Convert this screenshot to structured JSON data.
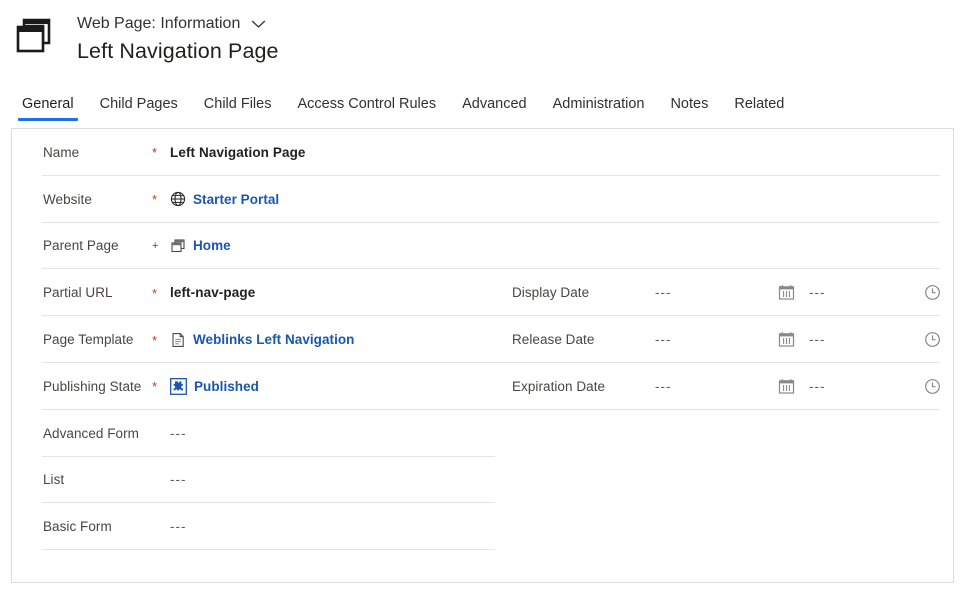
{
  "header": {
    "app_icon": "web-pages-icon",
    "entity_label": "Web Page: Information",
    "chevron_icon": "chevron-down-icon",
    "record_title": "Left Navigation Page"
  },
  "tabs": [
    {
      "label": "General",
      "active": true
    },
    {
      "label": "Child Pages",
      "active": false
    },
    {
      "label": "Child Files",
      "active": false
    },
    {
      "label": "Access Control Rules",
      "active": false
    },
    {
      "label": "Advanced",
      "active": false
    },
    {
      "label": "Administration",
      "active": false
    },
    {
      "label": "Notes",
      "active": false
    },
    {
      "label": "Related",
      "active": false
    }
  ],
  "form": {
    "left_fields": [
      {
        "label": "Name",
        "marker": "required",
        "value": "Left Navigation Page",
        "kind": "text",
        "icon": null
      },
      {
        "label": "Website",
        "marker": "required",
        "value": "Starter Portal",
        "kind": "link",
        "icon": "globe-icon"
      },
      {
        "label": "Parent Page",
        "marker": "recommended",
        "value": "Home",
        "kind": "link",
        "icon": "pages-icon"
      },
      {
        "label": "Partial URL",
        "marker": "required",
        "value": "left-nav-page",
        "kind": "text",
        "icon": null
      },
      {
        "label": "Page Template",
        "marker": "required",
        "value": "Weblinks Left Navigation",
        "kind": "link",
        "icon": "document-icon"
      },
      {
        "label": "Publishing State",
        "marker": "required",
        "value": "Published",
        "kind": "link",
        "icon": "component-icon"
      },
      {
        "label": "Advanced Form",
        "marker": "none",
        "value": "---",
        "kind": "empty",
        "icon": null
      },
      {
        "label": "List",
        "marker": "none",
        "value": "---",
        "kind": "empty",
        "icon": null
      },
      {
        "label": "Basic Form",
        "marker": "none",
        "value": "---",
        "kind": "empty",
        "icon": null
      }
    ],
    "right_fields": [
      {
        "label": "Display Date",
        "date_value": "---",
        "date_icon": "calendar-icon",
        "time_value": "---",
        "time_icon": "clock-icon"
      },
      {
        "label": "Release Date",
        "date_value": "---",
        "date_icon": "calendar-icon",
        "time_value": "---",
        "time_icon": "clock-icon"
      },
      {
        "label": "Expiration Date",
        "date_value": "---",
        "date_icon": "calendar-icon",
        "time_value": "---",
        "time_icon": "clock-icon"
      }
    ],
    "markers": {
      "required_glyph": "*",
      "recommended_glyph": "+"
    }
  },
  "colors": {
    "link": "#1a56b0",
    "required": "#c0392b",
    "recommended": "#1f4ed8",
    "tab_active_underline": "#1f6feb",
    "divider": "#e4e4e4",
    "card_border": "#dcdcdc",
    "label_text": "#484644",
    "value_text": "#201f1e"
  }
}
